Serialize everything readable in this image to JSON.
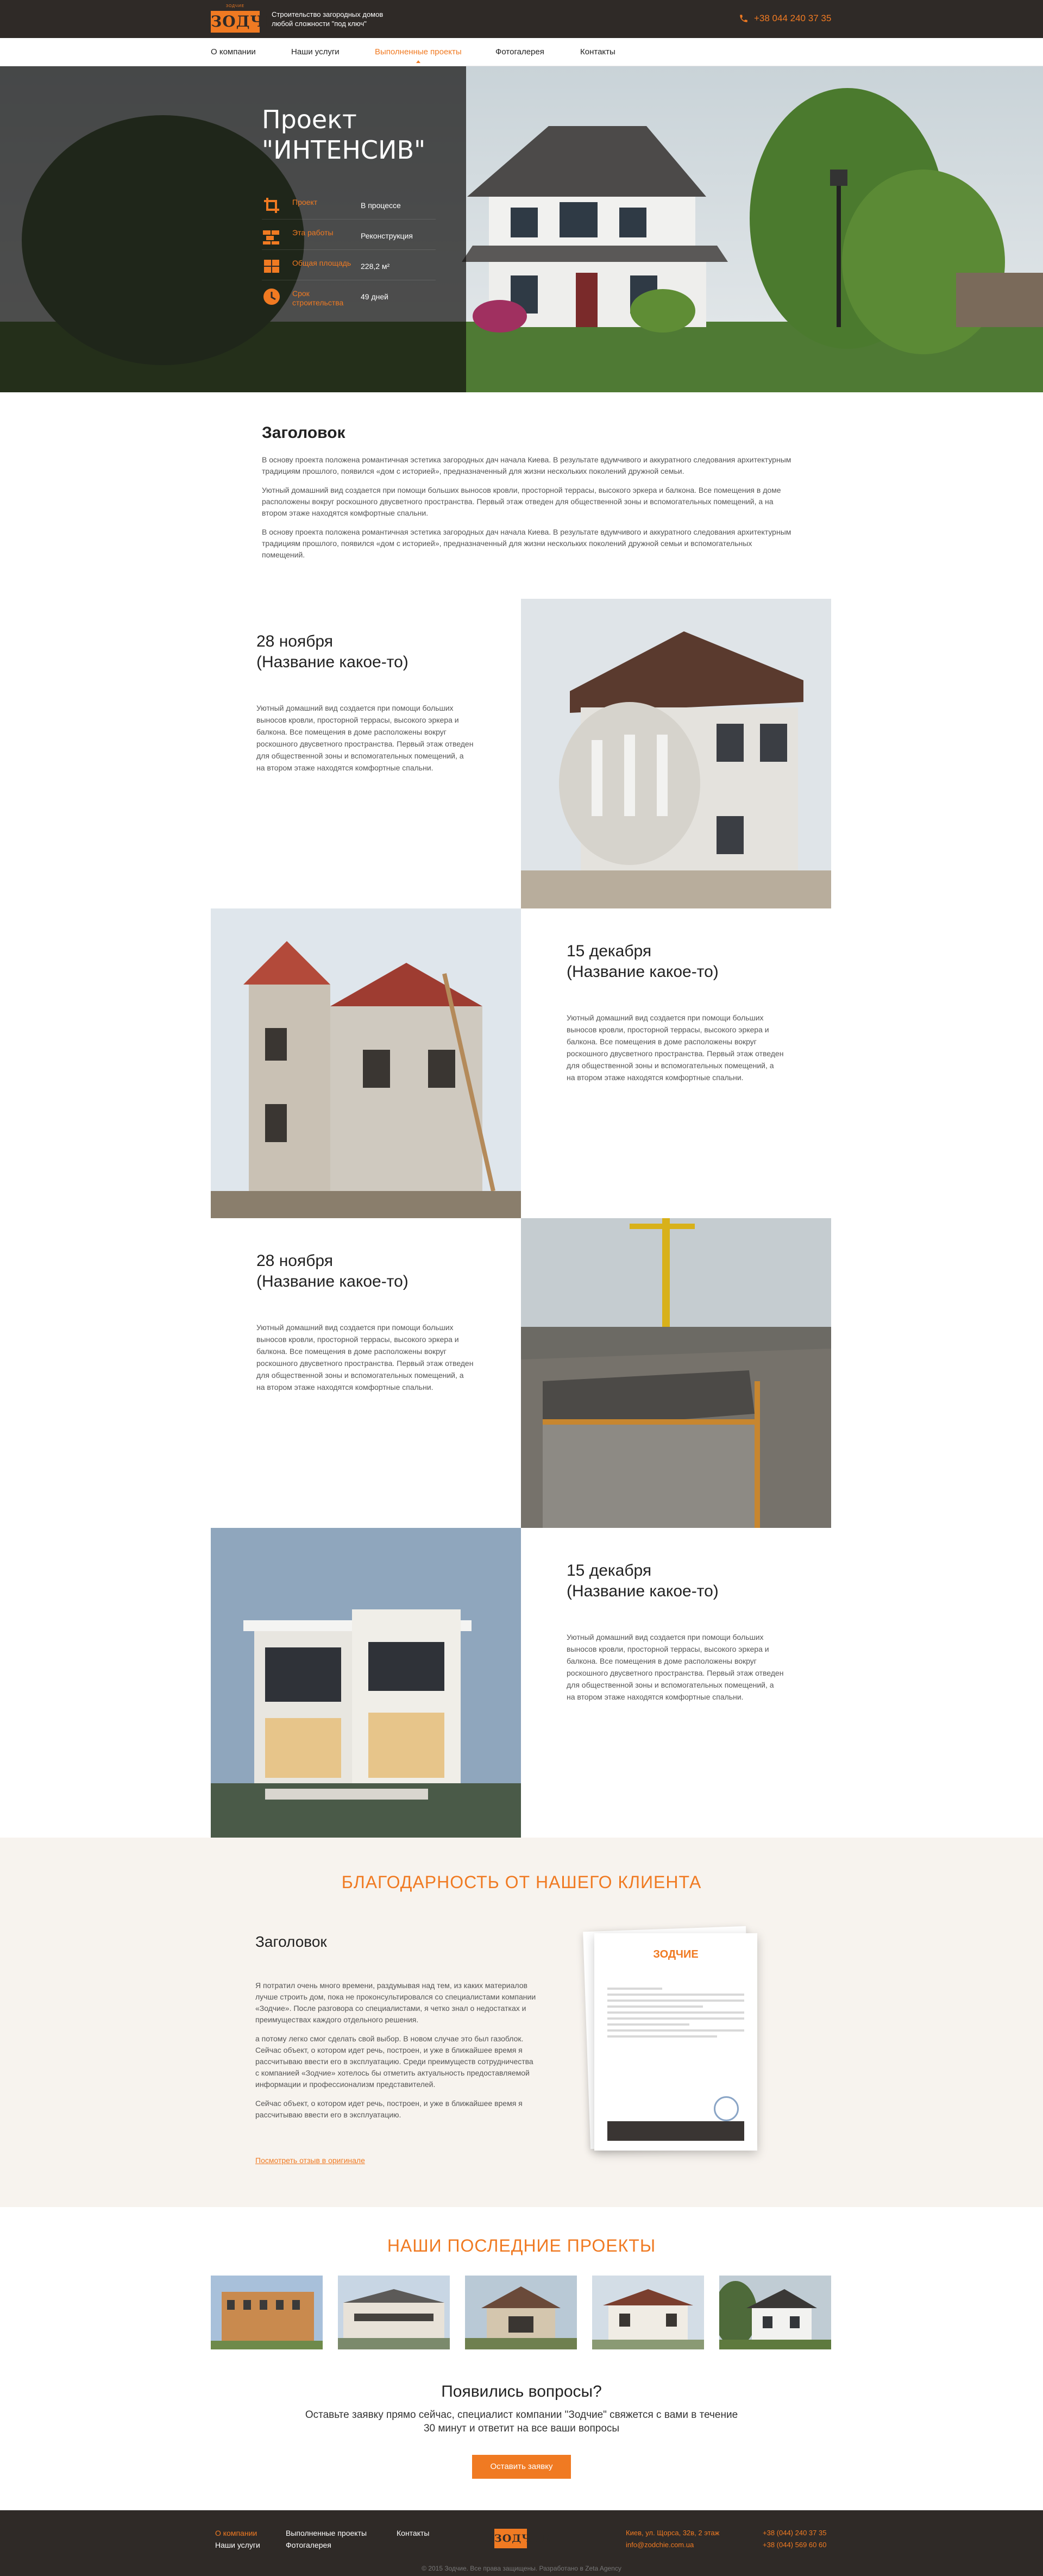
{
  "header": {
    "logo_crown": "ЗОДЧИЕ",
    "logo_text": "ЗОДЧИЕ",
    "tagline": "Строительство загородных домов любой сложности \"под ключ\"",
    "phone": "+38 044 240 37 35"
  },
  "nav": {
    "items": [
      "О компании",
      "Наши услуги",
      "Выполненные проекты",
      "Фотогалерея",
      "Контакты"
    ],
    "active": "Выполненные проекты"
  },
  "hero": {
    "title_line1": "Проект",
    "title_line2": "\"ИНТЕНСИВ\"",
    "stats": [
      {
        "label": "Проект",
        "value": "В процессе",
        "icon": "crop-icon"
      },
      {
        "label": "Эта работы",
        "value": "Реконструкция",
        "icon": "bricks-icon"
      },
      {
        "label": "Общая площадь",
        "value": "228,2 м²",
        "icon": "area-icon"
      },
      {
        "label": "Срок строительства",
        "value": "49 дней",
        "icon": "clock-icon"
      }
    ]
  },
  "intro": {
    "heading": "Заголовок",
    "paragraphs": [
      "В основу проекта положена романтичная эстетика загородных дач начала Киева. В результате вдумчивого и аккуратного следования архитектурным традициям прошлого, появился «дом с историей», предназначенный для жизни нескольких поколений дружной семьи.",
      "Уютный домашний вид создается при помощи больших выносов кровли, просторной террасы, высокого эркера и балкона. Все помещения в доме расположены вокруг роскошного двусветного пространства. Первый этаж отведен для общественной зоны и вспомогательных помещений, а на втором этаже находятся комфортные спальни.",
      "В основу проекта положена романтичная эстетика загородных дач начала Киева. В результате вдумчивого и аккуратного следования архитектурным традициям прошлого, появился «дом с историей», предназначенный для жизни нескольких поколений дружной семьи и вспомогательных помещений."
    ]
  },
  "timeline": [
    {
      "date": "28 ноября",
      "name": "(Название какое-то)",
      "text": "Уютный домашний вид создается при помощи больших выносов кровли, просторной террасы, высокого эркера и балкона. Все помещения в доме расположены вокруг роскошного двусветного пространства. Первый этаж отведен для общественной зоны и вспомогательных помещений, а на втором этаже находятся комфортные спальни."
    },
    {
      "date": "15 декабря",
      "name": "(Название какое-то)",
      "text": "Уютный домашний вид создается при помощи больших выносов кровли, просторной террасы, высокого эркера и балкона. Все помещения в доме расположены вокруг роскошного двусветного пространства. Первый этаж отведен для общественной зоны и вспомогательных помещений, а на втором этаже находятся комфортные спальни."
    },
    {
      "date": "28 ноября",
      "name": "(Название какое-то)",
      "text": "Уютный домашний вид создается при помощи больших выносов кровли, просторной террасы, высокого эркера и балкона. Все помещения в доме расположены вокруг роскошного двусветного пространства. Первый этаж отведен для общественной зоны и вспомогательных помещений, а на втором этаже находятся комфортные спальни."
    },
    {
      "date": "15 декабря",
      "name": "(Название какое-то)",
      "text": "Уютный домашний вид создается при помощи больших выносов кровли, просторной террасы, высокого эркера и балкона. Все помещения в доме расположены вокруг роскошного двусветного пространства. Первый этаж отведен для общественной зоны и вспомогательных помещений, а на втором этаже находятся комфортные спальни."
    }
  ],
  "testimonial": {
    "section_title": "БЛАГОДАРНОСТЬ ОТ НАШЕГО КЛИЕНТА",
    "heading": "Заголовок",
    "paragraphs": [
      "Я потратил очень много времени, раздумывая над тем, из каких материалов лучше строить дом, пока не проконсультировался со специалистами компании «Зодчие». После разговора со специалистами, я четко знал о недостатках и преимуществах каждого отдельного решения.",
      "а потому легко смог сделать свой выбор. В новом случае это был газоблок. Сейчас объект, о котором идет речь, построен, и уже в ближайшее время я рассчитываю ввести его в эксплуатацию. Среди преимуществ сотрудничества с компанией «Зодчие» хотелось бы отметить актуальность предоставляемой информации и профессионализм представителей.",
      "Сейчас объект, о котором идет речь, построен, и уже в ближайшее время я рассчитываю ввести его в эксплуатацию."
    ],
    "link": "Посмотреть отзыв в оригинале",
    "letter_logo": "ЗОДЧИЕ"
  },
  "projects": {
    "title": "НАШИ ПОСЛЕДНИЕ ПРОЕКТЫ"
  },
  "cta": {
    "title": "Появились вопросы?",
    "text": "Оставьте заявку прямо сейчас, специалист компании \"Зодчие\" свяжется с вами в течение 30 минут и ответит на все ваши вопросы",
    "button": "Оставить заявку"
  },
  "footer": {
    "col1": [
      "О компании",
      "Наши услуги"
    ],
    "col2": [
      "Выполненные проекты",
      "Фотогалерея"
    ],
    "col3": [
      "Контакты"
    ],
    "logo_text": "ЗОДЧИЕ",
    "address": "Киев, ул. Щорса, 32в, 2 этаж",
    "email": "info@zodchie.com.ua",
    "phone1": "+38 (044) 240 37 35",
    "phone2": "+38 (044) 569 60 60",
    "copyright": "© 2015 Зодчие. Все права защищены.  Разработано в Zeta Agency"
  },
  "colors": {
    "accent": "#f07a22",
    "dark": "#2f2a27",
    "cream": "#f7f3ee"
  }
}
